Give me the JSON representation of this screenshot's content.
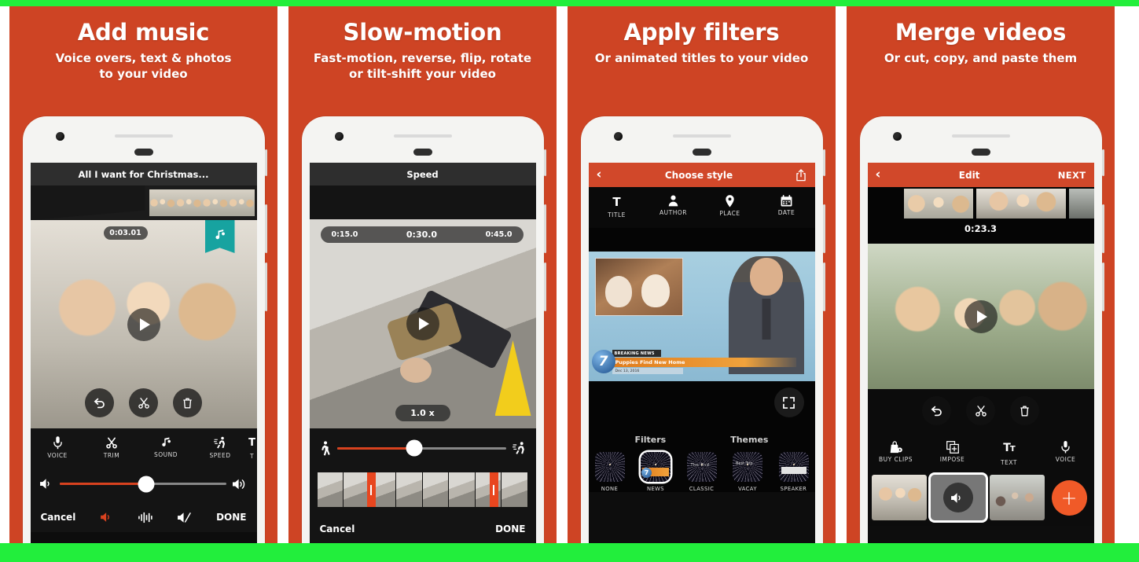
{
  "theme": {
    "brand_orange": "#ce4424",
    "accent_orange": "#d8421f",
    "border_green": "#22ee3c",
    "screen_black": "#0d0d0d",
    "teal_badge": "#17a3a0"
  },
  "panels": [
    {
      "id": "add-music",
      "title": "Add music",
      "subtitle_line1": "Voice overs, text & photos",
      "subtitle_line2": "to your video",
      "screen": {
        "topbar_title": "All I want for Christmas...",
        "timestamp": "0:03.01",
        "music_badge_icon": "music-note-icon",
        "video_actions": [
          "undo-icon",
          "scissors-icon",
          "trash-icon"
        ],
        "tools": [
          {
            "label": "VOICE",
            "icon": "microphone-icon"
          },
          {
            "label": "TRIM",
            "icon": "scissors-icon"
          },
          {
            "label": "SOUND",
            "icon": "music-note-icon"
          },
          {
            "label": "SPEED",
            "icon": "runner-icon"
          },
          {
            "label": "T",
            "icon": "text-icon"
          }
        ],
        "volume": {
          "left_icon": "volume-low-icon",
          "right_icon": "volume-high-icon",
          "value_pct": 52
        },
        "footer": {
          "cancel": "Cancel",
          "done": "DONE",
          "icons": [
            "volume-icon",
            "waveform-icon",
            "mute-icon"
          ]
        }
      }
    },
    {
      "id": "slow-motion",
      "title": "Slow-motion",
      "subtitle_line1": "Fast-motion, reverse, flip, rotate",
      "subtitle_line2": "or tilt-shift your video",
      "screen": {
        "topbar_title": "Speed",
        "timestamps": [
          "0:15.0",
          "0:30.0",
          "0:45.0"
        ],
        "speed_badge": "1.0 x",
        "speed_slider": {
          "left_icon": "walking-icon",
          "right_icon": "running-icon",
          "value_pct": 46
        },
        "footer": {
          "cancel": "Cancel",
          "done": "DONE"
        }
      }
    },
    {
      "id": "apply-filters",
      "title": "Apply filters",
      "subtitle_line1": "Or animated titles to your video",
      "subtitle_line2": "",
      "screen": {
        "topbar_title": "Choose style",
        "back_icon": "chevron-left-icon",
        "share_icon": "share-icon",
        "meta_tabs": [
          {
            "label": "TITLE",
            "icon": "text-t-icon"
          },
          {
            "label": "AUTHOR",
            "icon": "person-icon"
          },
          {
            "label": "PLACE",
            "icon": "location-pin-icon"
          },
          {
            "label": "DATE",
            "icon": "calendar-icon"
          }
        ],
        "news_overlay": {
          "kicker": "BREAKING NEWS",
          "headline": "Puppies Find New Home",
          "date": "Dec 13, 2016",
          "channel": "7"
        },
        "expand_icon": "fullscreen-expand-icon",
        "section_left": "Filters",
        "section_right": "Themes",
        "styles": [
          {
            "label": "NONE",
            "selected": false
          },
          {
            "label": "NEWS",
            "selected": true
          },
          {
            "label": "CLASSIC",
            "selected": false
          },
          {
            "label": "VACAY",
            "selected": false
          },
          {
            "label": "SPEAKER",
            "selected": false
          }
        ]
      }
    },
    {
      "id": "merge-videos",
      "title": "Merge videos",
      "subtitle_line1": "Or cut, copy, and paste them",
      "subtitle_line2": "",
      "screen": {
        "topbar_title": "Edit",
        "back_icon": "chevron-left-icon",
        "next_label": "NEXT",
        "timestamp": "0:23.3",
        "video_actions": [
          "undo-icon",
          "scissors-icon",
          "trash-icon"
        ],
        "tools": [
          {
            "label": "BUY CLIPS",
            "icon": "shopping-bag-icon"
          },
          {
            "label": "IMPOSE",
            "icon": "layers-plus-icon"
          },
          {
            "label": "TEXT",
            "icon": "text-tt-icon"
          },
          {
            "label": "VOICE",
            "icon": "microphone-icon"
          }
        ],
        "clips": [
          {
            "selected": false,
            "muted": false
          },
          {
            "selected": true,
            "muted": true
          },
          {
            "selected": false,
            "muted": false
          }
        ],
        "add_clip_label": "+"
      }
    }
  ]
}
